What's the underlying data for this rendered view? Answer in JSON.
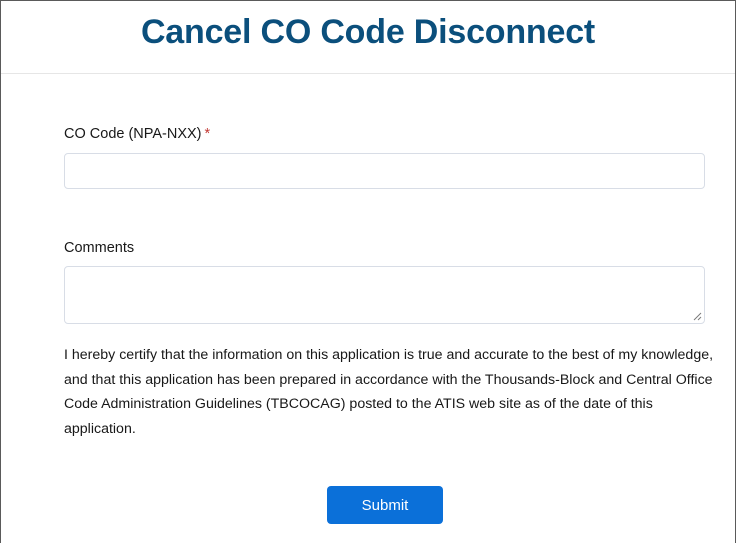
{
  "header": {
    "title": "Cancel CO Code Disconnect"
  },
  "form": {
    "co_code": {
      "label": "CO Code (NPA-NXX)",
      "required_marker": "*",
      "value": "",
      "placeholder": ""
    },
    "comments": {
      "label": "Comments",
      "value": "",
      "placeholder": ""
    },
    "certification_text": "I hereby certify that the information on this application is true and accurate to the best of my knowledge, and that this application has been prepared in accordance with the Thousands-Block and Central Office Code Administration Guidelines (TBCOCAG) posted to the ATIS web site as of the date of this application.",
    "submit_label": "Submit"
  },
  "colors": {
    "title": "#0b4f7c",
    "required": "#c23934",
    "button": "#0b70d9",
    "border": "#d8dde6"
  },
  "icons": {
    "textarea_resize": "resize-handle-icon"
  }
}
